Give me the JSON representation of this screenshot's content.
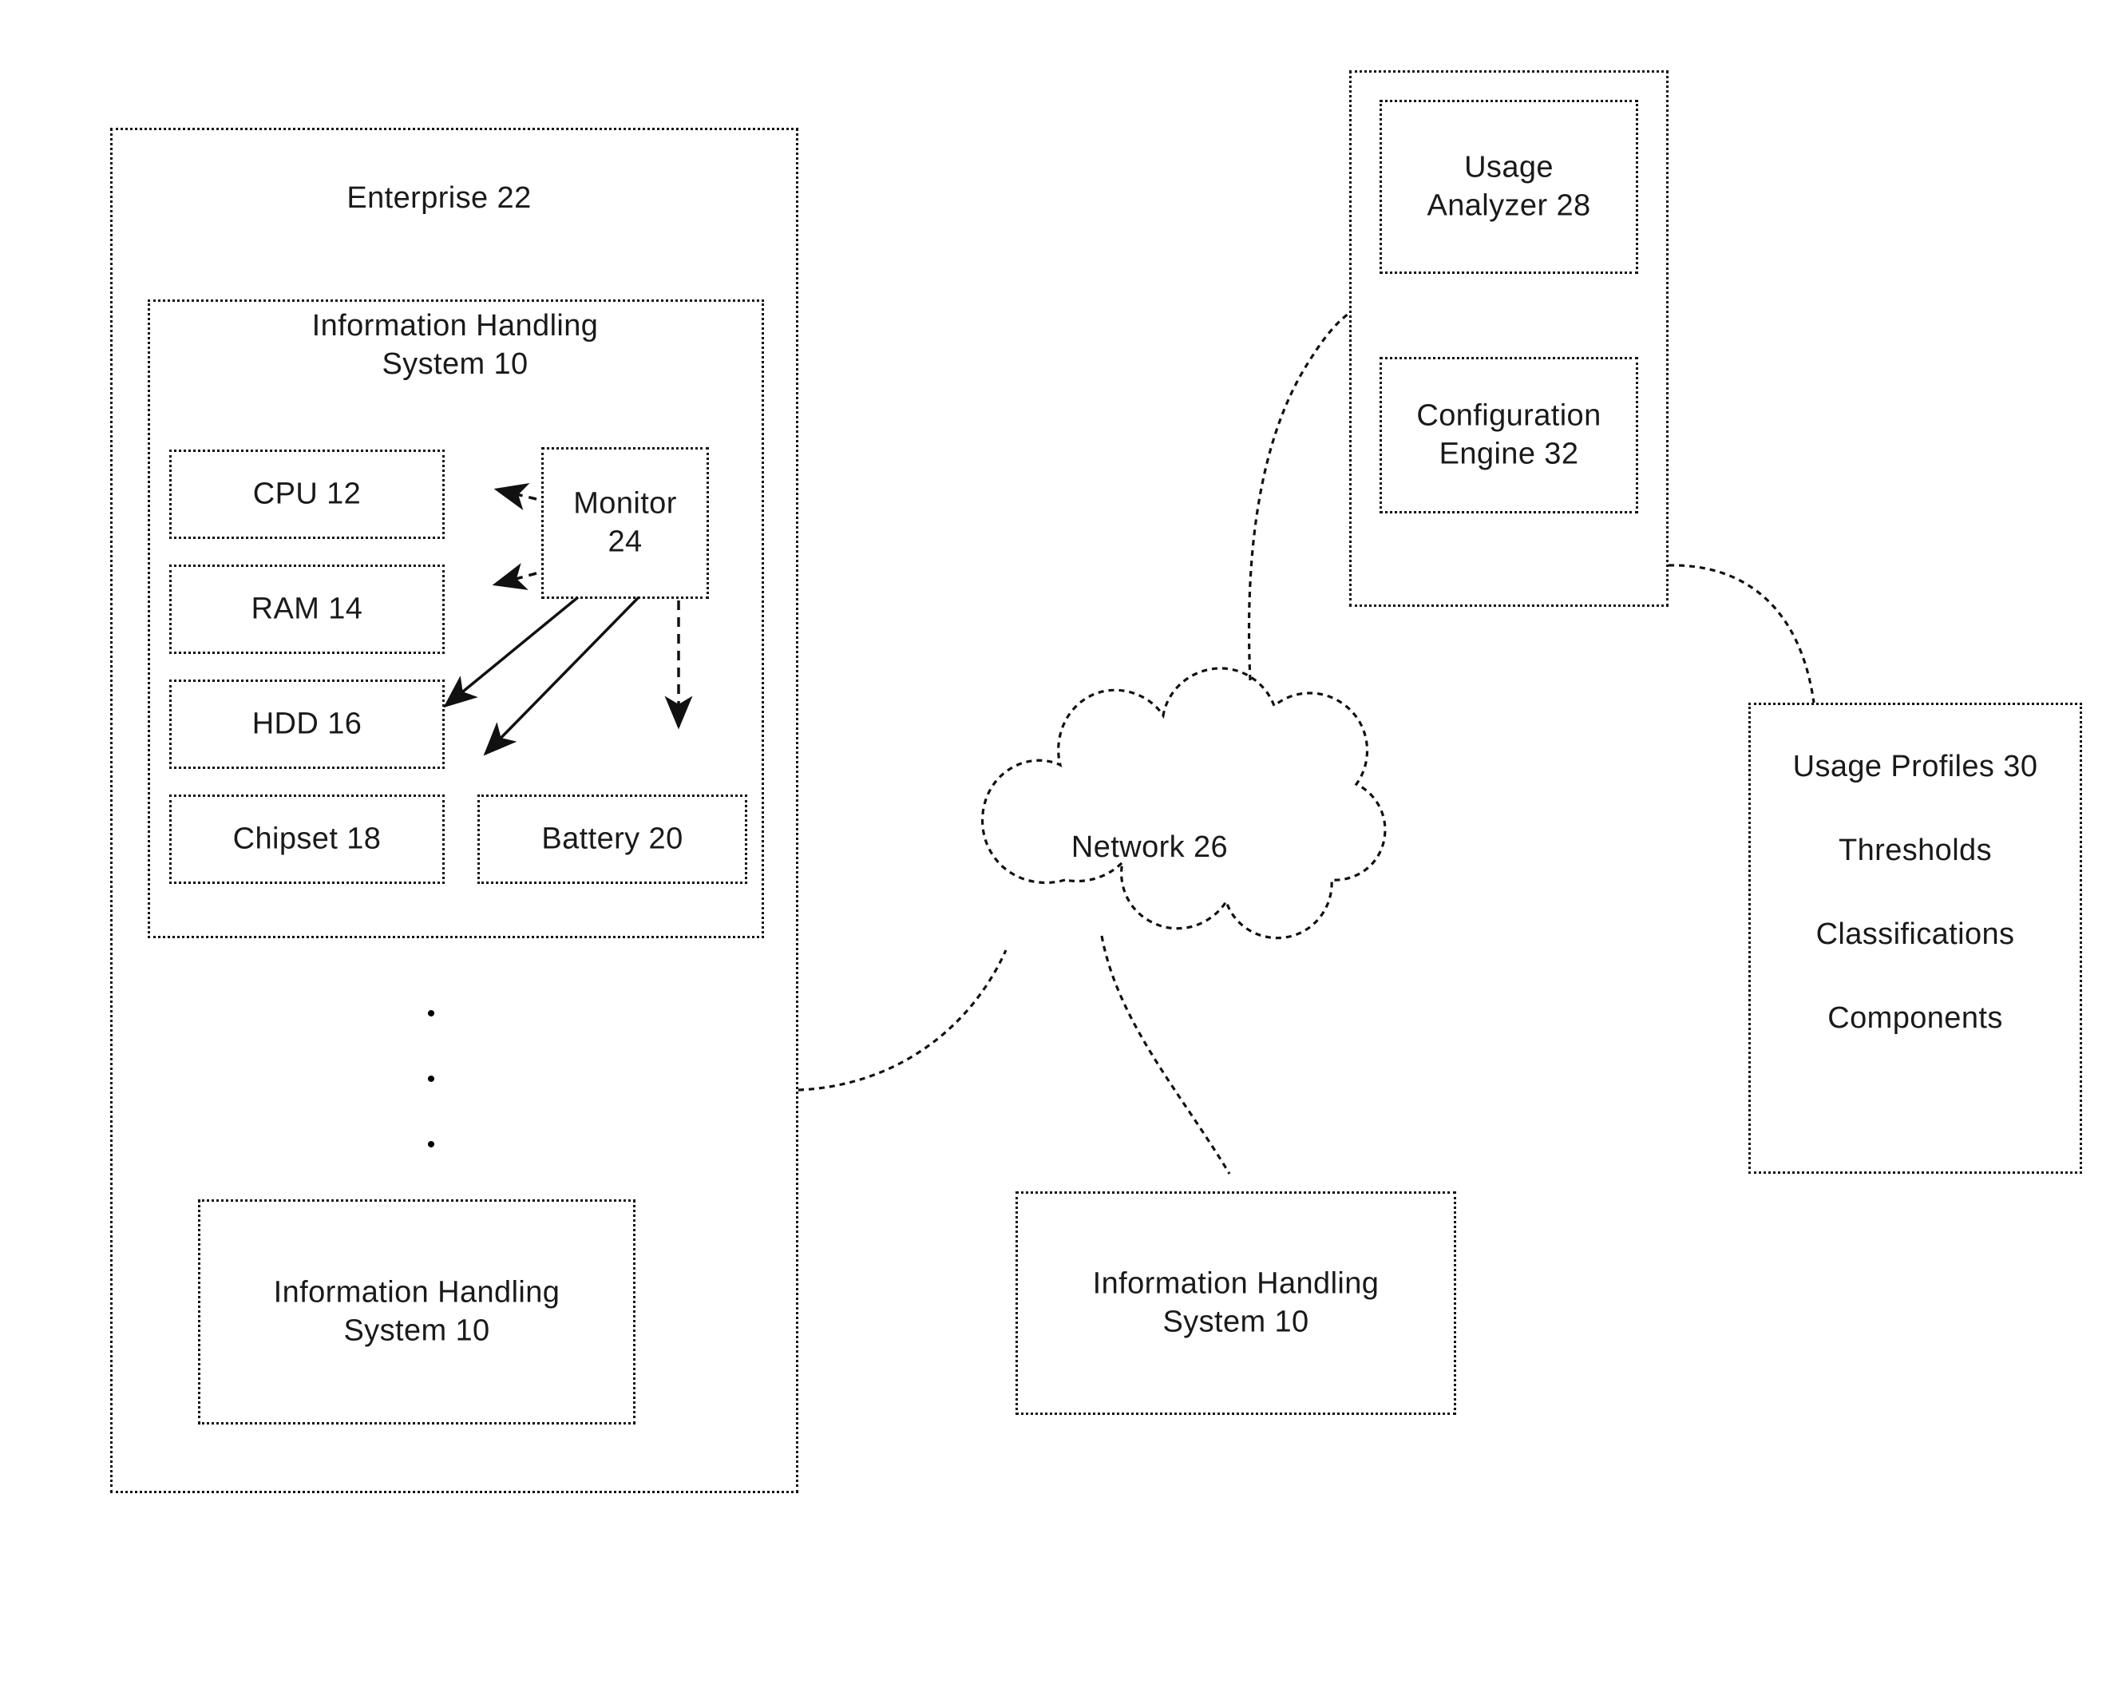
{
  "figure": {
    "type": "patent-block-diagram",
    "background_color": "#ffffff",
    "line_color": "#111111"
  },
  "enterprise": {
    "label": "Enterprise 22"
  },
  "information_handling_system_main": {
    "label": "Information Handling\nSystem 10",
    "components": [
      {
        "label": "CPU 12",
        "name": "cpu"
      },
      {
        "label": "RAM 14",
        "name": "ram"
      },
      {
        "label": "HDD 16",
        "name": "hdd"
      },
      {
        "label": "Chipset 18",
        "name": "chipset"
      },
      {
        "label": "Battery 20",
        "name": "battery"
      }
    ],
    "monitor": {
      "label": "Monitor\n24"
    }
  },
  "enterprise_ellipsis": [
    "•",
    "•",
    "•"
  ],
  "information_handling_system_enterprise_bottom": {
    "label": "Information Handling\nSystem 10"
  },
  "network": {
    "label": "Network 26",
    "shape": "cloud"
  },
  "information_handling_system_remote": {
    "label": "Information Handling\nSystem 10"
  },
  "analyzer_block": {
    "usage_analyzer": {
      "label": "Usage\nAnalyzer 28"
    },
    "configuration_engine": {
      "label": "Configuration\nEngine 32"
    }
  },
  "usage_profiles": {
    "title": "Usage Profiles 30",
    "items": [
      "Thresholds",
      "Classifications",
      "Components"
    ]
  },
  "connections": [
    {
      "from": "monitor-24",
      "to": "cpu-12",
      "style": "dashed-arrow"
    },
    {
      "from": "monitor-24",
      "to": "ram-14",
      "style": "dashed-arrow"
    },
    {
      "from": "monitor-24",
      "to": "hdd-16",
      "style": "solid-arrow"
    },
    {
      "from": "monitor-24",
      "to": "chipset-18",
      "style": "solid-arrow"
    },
    {
      "from": "monitor-24",
      "to": "battery-20",
      "style": "dashed-arrow"
    },
    {
      "from": "enterprise-22",
      "to": "network-26",
      "style": "curve"
    },
    {
      "from": "network-26",
      "to": "analyzer-block",
      "style": "curve"
    },
    {
      "from": "network-26",
      "to": "information-handling-system-remote",
      "style": "curve"
    },
    {
      "from": "analyzer-block",
      "to": "usage-profiles-30",
      "style": "curve"
    }
  ]
}
